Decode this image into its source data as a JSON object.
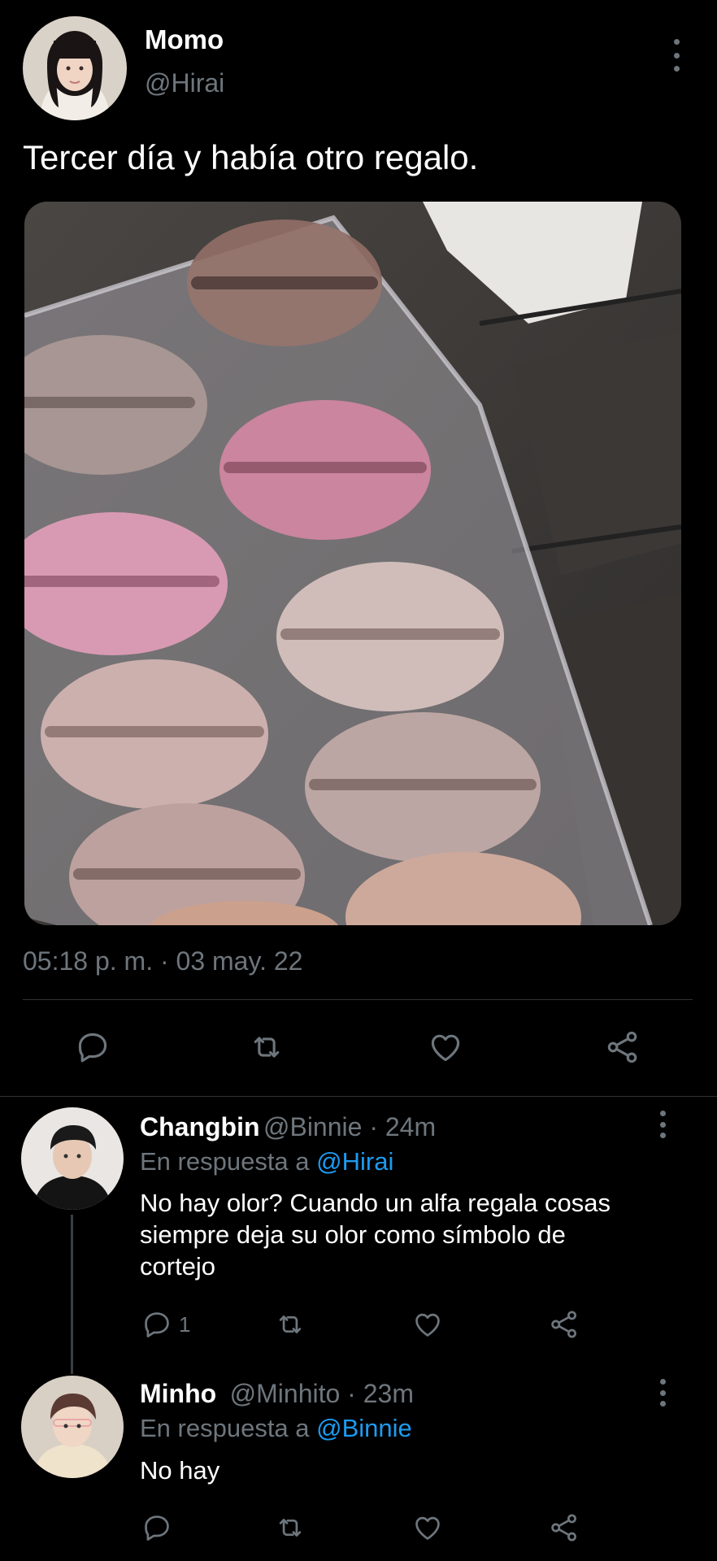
{
  "tweet": {
    "author_name": "Momo",
    "author_handle": "@Hirai",
    "text": "Tercer día y había otro regalo.",
    "timestamp": "05:18 p. m. · 03 may. 22"
  },
  "replies": [
    {
      "name": "Changbin",
      "handle_time": "@Binnie · 24m",
      "reply_prefix": "En respuesta a ",
      "reply_target": "@Hirai",
      "text_lines": [
        "No hay olor? Cuando un alfa regala cosas",
        "siempre deja su olor como símbolo de",
        "cortejo"
      ],
      "reply_count": "1"
    },
    {
      "name": "Minho",
      "handle_time": "@Minhito · 23m",
      "reply_prefix": "En respuesta a ",
      "reply_target": "@Binnie",
      "text_lines": [
        "No hay"
      ],
      "reply_count": ""
    }
  ],
  "icons": {
    "reply": "reply-icon",
    "retweet": "retweet-icon",
    "like": "heart-icon",
    "share": "share-icon",
    "more": "more-vertical-icon"
  },
  "colors": {
    "background": "#000000",
    "muted": "#6e767d",
    "link": "#1d9bf0",
    "divider": "#2f3336"
  }
}
